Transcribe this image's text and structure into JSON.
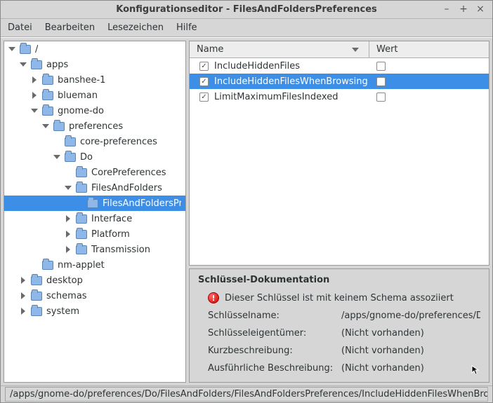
{
  "window": {
    "title": "Konfigurationseditor - FilesAndFoldersPreferences"
  },
  "menubar": {
    "file": "Datei",
    "edit": "Bearbeiten",
    "bookmarks": "Lesezeichen",
    "help": "Hilfe"
  },
  "tree": {
    "root": "/",
    "apps": "apps",
    "banshee": "banshee-1",
    "blueman": "blueman",
    "gnomedo": "gnome-do",
    "preferences": "preferences",
    "coreprefs": "core-preferences",
    "do": "Do",
    "coreprefs2": "CorePreferences",
    "filesfolders": "FilesAndFolders",
    "ffprefs": "FilesAndFoldersPreferen",
    "interface": "Interface",
    "platform": "Platform",
    "transmission": "Transmission",
    "nmapplet": "nm-applet",
    "desktop": "desktop",
    "schemas": "schemas",
    "system": "system"
  },
  "table": {
    "col_name": "Name",
    "col_value": "Wert",
    "rows": [
      {
        "name": "IncludeHiddenFiles",
        "checked": true,
        "selected": false,
        "wert_checked": false
      },
      {
        "name": "IncludeHiddenFilesWhenBrowsing",
        "checked": true,
        "selected": true,
        "wert_checked": false
      },
      {
        "name": "LimitMaximumFilesIndexed",
        "checked": true,
        "selected": false,
        "wert_checked": false
      }
    ]
  },
  "doc": {
    "heading": "Schlüssel-Dokumentation",
    "warn": "Dieser Schlüssel ist mit keinem Schema assoziiert",
    "lbl_name": "Schlüsselname:",
    "val_name": "/apps/gnome-do/preferences/Do/FilesAndFolders/FilesAndFoldersPreferences/IncludeHiddenFilesWhenBrowsing",
    "lbl_owner": "Schlüsseleigentümer:",
    "val_owner": "(Nicht vorhanden)",
    "lbl_short": "Kurzbeschreibung:",
    "val_short": "(Nicht vorhanden)",
    "lbl_long": "Ausführliche Beschreibung:",
    "val_long": "(Nicht vorhanden)"
  },
  "status": {
    "path": "/apps/gnome-do/preferences/Do/FilesAndFolders/FilesAndFoldersPreferences/IncludeHiddenFilesWhenBrow…"
  }
}
